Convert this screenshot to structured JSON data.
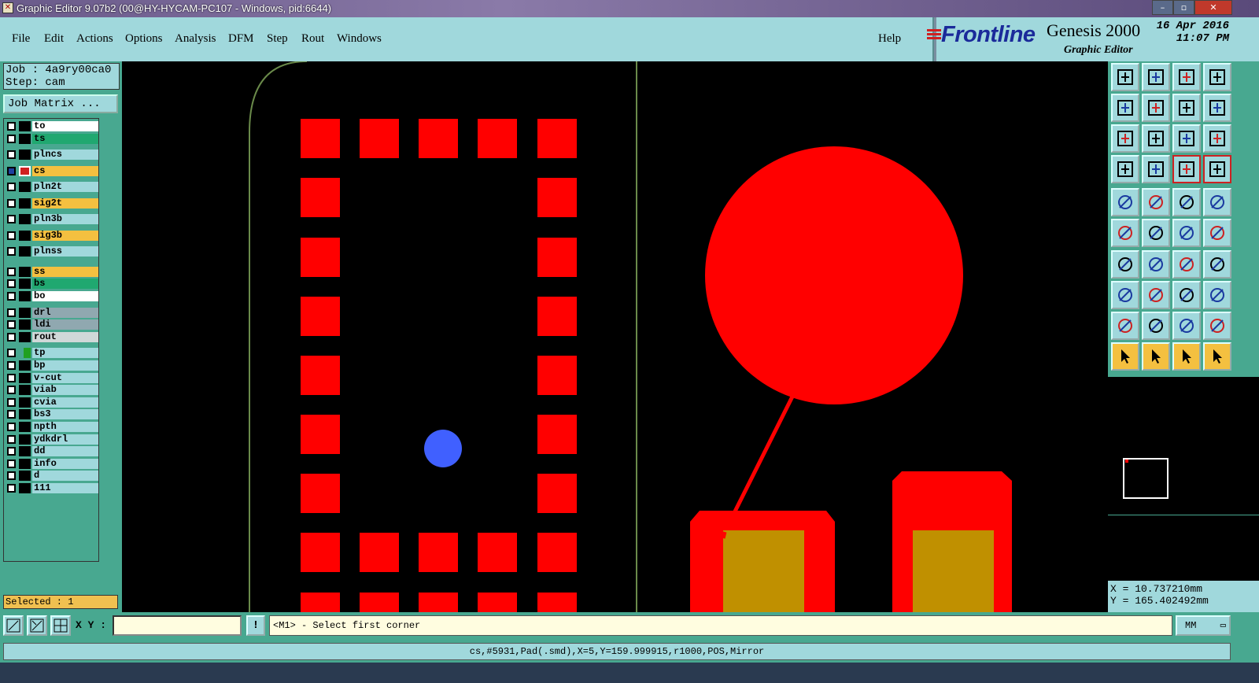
{
  "window": {
    "title": "Graphic Editor 9.07b2 (00@HY-HYCAM-PC107 - Windows, pid:6644)",
    "minimize": "–",
    "maximize": "▫",
    "close": "✕"
  },
  "menu": [
    "File",
    "Edit",
    "Actions",
    "Options",
    "Analysis",
    "DFM",
    "Step",
    "Rout",
    "Windows"
  ],
  "help": "Help",
  "brand": {
    "logo": "Frontline",
    "product": "Genesis 2000",
    "subtitle": "Graphic Editor",
    "date": "16 Apr 2016",
    "time": "11:07 PM"
  },
  "job": {
    "job_line": "Job : 4a9ry00ca0",
    "step_line": "Step: cam",
    "matrix_button": "Job Matrix ..."
  },
  "layers": [
    {
      "name": "to",
      "color": "#ffffff",
      "group": 0
    },
    {
      "name": "ts",
      "color": "#20a870",
      "group": 0
    },
    {
      "name": "plncs",
      "color": "#a0d8dc",
      "group": 1
    },
    {
      "name": "cs",
      "color": "#f4c040",
      "group": 1,
      "active": true
    },
    {
      "name": "pln2t",
      "color": "#a0d8dc",
      "group": 1
    },
    {
      "name": "sig2t",
      "color": "#f4c040",
      "group": 1
    },
    {
      "name": "pln3b",
      "color": "#a0d8dc",
      "group": 1
    },
    {
      "name": "sig3b",
      "color": "#f4c040",
      "group": 1
    },
    {
      "name": "plnss",
      "color": "#a0d8dc",
      "group": 1
    },
    {
      "name": "ss",
      "color": "#f4c040",
      "group": 2
    },
    {
      "name": "bs",
      "color": "#20a870",
      "group": 2
    },
    {
      "name": "bo",
      "color": "#ffffff",
      "group": 2
    },
    {
      "name": "drl",
      "color": "#90a8b0",
      "group": 3
    },
    {
      "name": "ldi",
      "color": "#90a8b0",
      "group": 3
    },
    {
      "name": "rout",
      "color": "#d0d8d8",
      "group": 3
    },
    {
      "name": "tp",
      "color": "#a0d8dc",
      "group": 4
    },
    {
      "name": "bp",
      "color": "#a0d8dc",
      "group": 4
    },
    {
      "name": "v-cut",
      "color": "#a0d8dc",
      "group": 4
    },
    {
      "name": "viab",
      "color": "#a0d8dc",
      "group": 4
    },
    {
      "name": "cvia",
      "color": "#a0d8dc",
      "group": 4
    },
    {
      "name": "bs3",
      "color": "#a0d8dc",
      "group": 4
    },
    {
      "name": "npth",
      "color": "#a0d8dc",
      "group": 4
    },
    {
      "name": "ydkdrl",
      "color": "#a0d8dc",
      "group": 4
    },
    {
      "name": "dd",
      "color": "#a0d8dc",
      "group": 4
    },
    {
      "name": "info",
      "color": "#a0d8dc",
      "group": 4
    },
    {
      "name": "d",
      "color": "#a0d8dc",
      "group": 4
    },
    {
      "name": "111",
      "color": "#a0d8dc",
      "group": 4
    }
  ],
  "selected": "Selected : 1",
  "coords": {
    "x": "X = 10.737210mm",
    "y": "Y = 165.402492mm"
  },
  "toolbar": {
    "xy_label": "X Y :",
    "xy_value": "",
    "msg_icon": "!",
    "message": "<M1> - Select first corner",
    "unit": "MM"
  },
  "status": "cs,#5931,Pad(.smd),X=5,Y=159.999915,r1000,POS,Mirror",
  "colors": {
    "pad": "#ff0000",
    "pad_inner": "#c09000",
    "drill": "#4060ff",
    "outline": "#6a8a4a"
  },
  "tool_icons": [
    "zoom-home-icon",
    "zoom-page-icon",
    "home-icon",
    "split-view-icon",
    "pan-left-icon",
    "pan-right-icon",
    "undo-view-icon",
    "flip-icon",
    "fit-icon",
    "zoom-fit-icon",
    "scale-1-2-icon",
    "help-query-icon",
    "tools-icon",
    "snap-icon",
    "net-icon",
    "net2-icon",
    "camera-icon",
    "measure-icon",
    "ruler-icon",
    "dot-icon",
    "connect-icon",
    "cross-icon",
    "move-point-icon",
    "move-point2-icon",
    "line-icon",
    "line2-icon",
    "arc-icon",
    "symbol-icon",
    "pad-icon",
    "dash-icon",
    "dim-icon",
    "copy-icon",
    "text-a-icon",
    "text-a2-icon",
    "text-a3-icon",
    "text-a4-icon",
    "select-icon",
    "select2-icon",
    "select3-icon",
    "select4-icon"
  ]
}
